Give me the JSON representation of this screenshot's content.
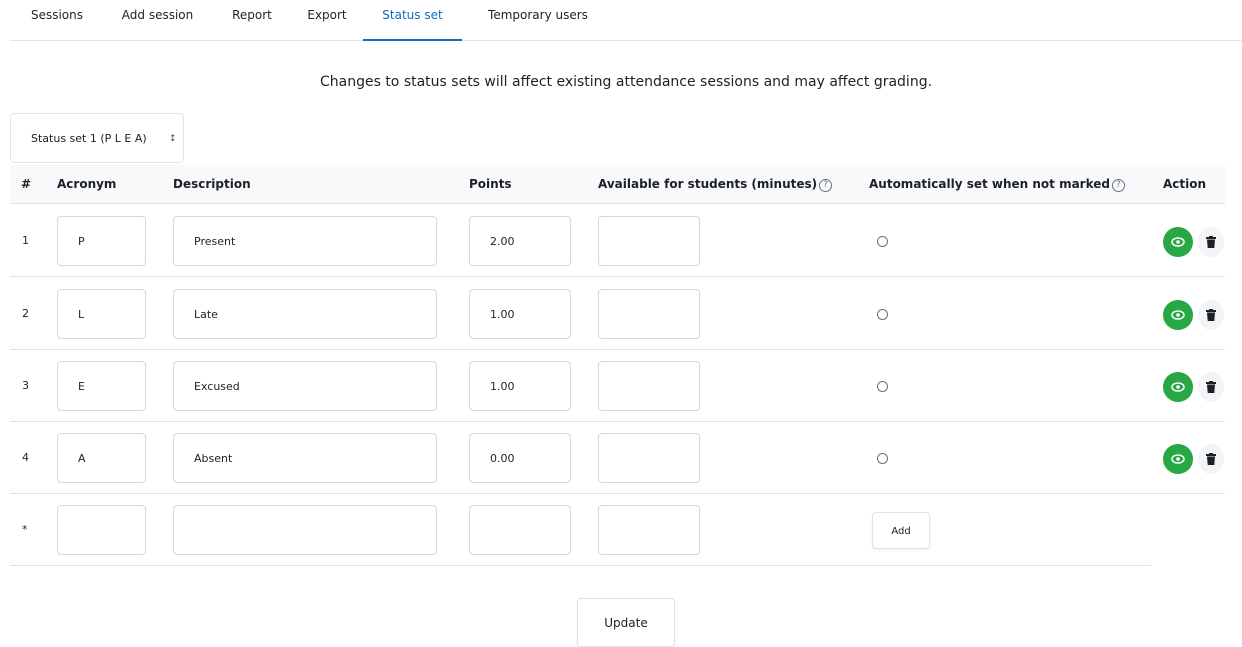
{
  "tabs": [
    {
      "label": "Sessions",
      "active": false
    },
    {
      "label": "Add session",
      "active": false
    },
    {
      "label": "Report",
      "active": false
    },
    {
      "label": "Export",
      "active": false
    },
    {
      "label": "Status set",
      "active": true
    },
    {
      "label": "Temporary users",
      "active": false
    }
  ],
  "notice": "Changes to status sets will affect existing attendance sessions and may affect grading.",
  "status_set_select": {
    "value": "Status set 1 (P L E A)"
  },
  "table": {
    "headers": {
      "num": "#",
      "acronym": "Acronym",
      "description": "Description",
      "points": "Points",
      "available": "Available for students (minutes)",
      "auto": "Automatically set when not marked",
      "action": "Action"
    },
    "rows": [
      {
        "num": "1",
        "acronym": "P",
        "description": "Present",
        "points": "2.00",
        "available": ""
      },
      {
        "num": "2",
        "acronym": "L",
        "description": "Late",
        "points": "1.00",
        "available": ""
      },
      {
        "num": "3",
        "acronym": "E",
        "description": "Excused",
        "points": "1.00",
        "available": ""
      },
      {
        "num": "4",
        "acronym": "A",
        "description": "Absent",
        "points": "0.00",
        "available": ""
      }
    ],
    "new_row": {
      "num": "*",
      "acronym": "",
      "description": "",
      "points": "",
      "available": ""
    }
  },
  "buttons": {
    "add": "Add",
    "update": "Update"
  },
  "colors": {
    "accent": "#0f6cbf",
    "visible_button": "#28a745"
  },
  "icons": {
    "help": "question-circle-icon",
    "visible": "eye-icon",
    "delete": "trash-icon",
    "sort": "sort-caret-icon"
  }
}
